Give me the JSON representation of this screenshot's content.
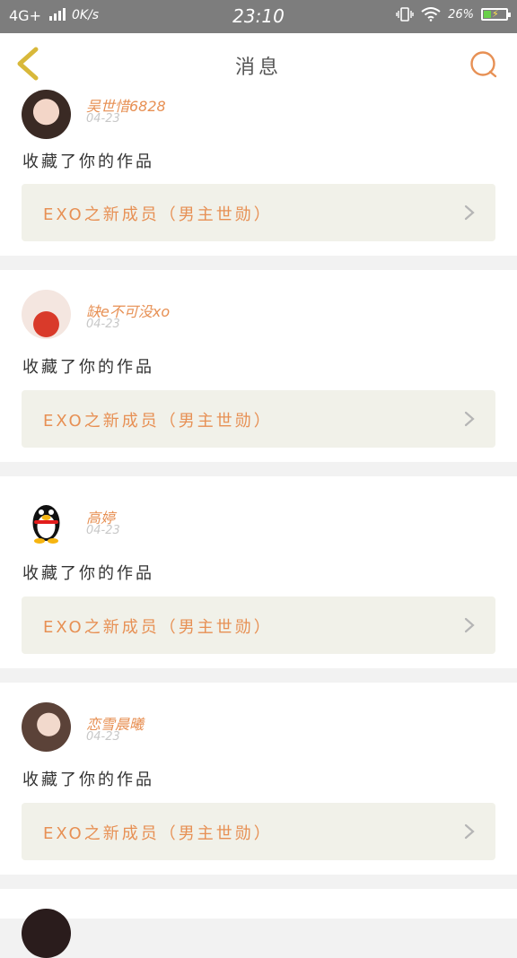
{
  "status_bar": {
    "network": "4G+",
    "speed": "0K/s",
    "time": "23:10",
    "battery": "26%"
  },
  "header": {
    "title": "消息",
    "back_icon": "chevron-left-icon",
    "search_icon": "search-icon"
  },
  "messages": [
    {
      "user": "吴世惜6828",
      "date": "04-23",
      "action": "收藏了你的作品",
      "work": "EXO之新成员（男主世勋）"
    },
    {
      "user": "缺e不可没xo",
      "date": "04-23",
      "action": "收藏了你的作品",
      "work": "EXO之新成员（男主世勋）"
    },
    {
      "user": "高婷",
      "date": "04-23",
      "action": "收藏了你的作品",
      "work": "EXO之新成员（男主世勋）"
    },
    {
      "user": "恋雪晨曦",
      "date": "04-23",
      "action": "收藏了你的作品",
      "work": "EXO之新成员（男主世勋）"
    }
  ],
  "colors": {
    "accent": "#e79054",
    "back_arrow": "#d8b83a",
    "status_bar": "#7d7d7d",
    "work_bg": "#f1f1e9"
  }
}
